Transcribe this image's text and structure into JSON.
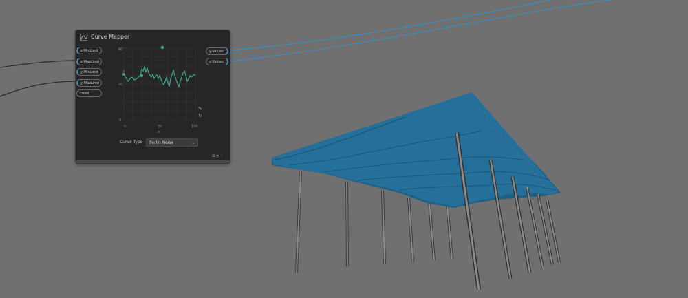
{
  "node": {
    "title": "Curve Mapper",
    "inputs": [
      "x-MinLimit",
      "x-MaxLimit",
      "y-MinLimit",
      "y-MaxLimit",
      "count"
    ],
    "outputs": [
      "y-Values",
      "x-Values"
    ],
    "curve_type_label": "Curve Type",
    "curve_type_value": "Perlin Noise",
    "plot": {
      "y_ticks": [
        "40",
        "20",
        "0"
      ],
      "x_ticks": [
        "0",
        "50",
        "100"
      ],
      "x_label": "x",
      "y_label": "y"
    }
  },
  "colors": {
    "background": "#707070",
    "node": "#262626",
    "wire": "#3e8fbf",
    "curve": "#3ea88e",
    "roof": "#236a90"
  },
  "icons": {
    "node": "curve-mapper-icon",
    "reset": "reset-icon",
    "edit": "edit-icon"
  }
}
